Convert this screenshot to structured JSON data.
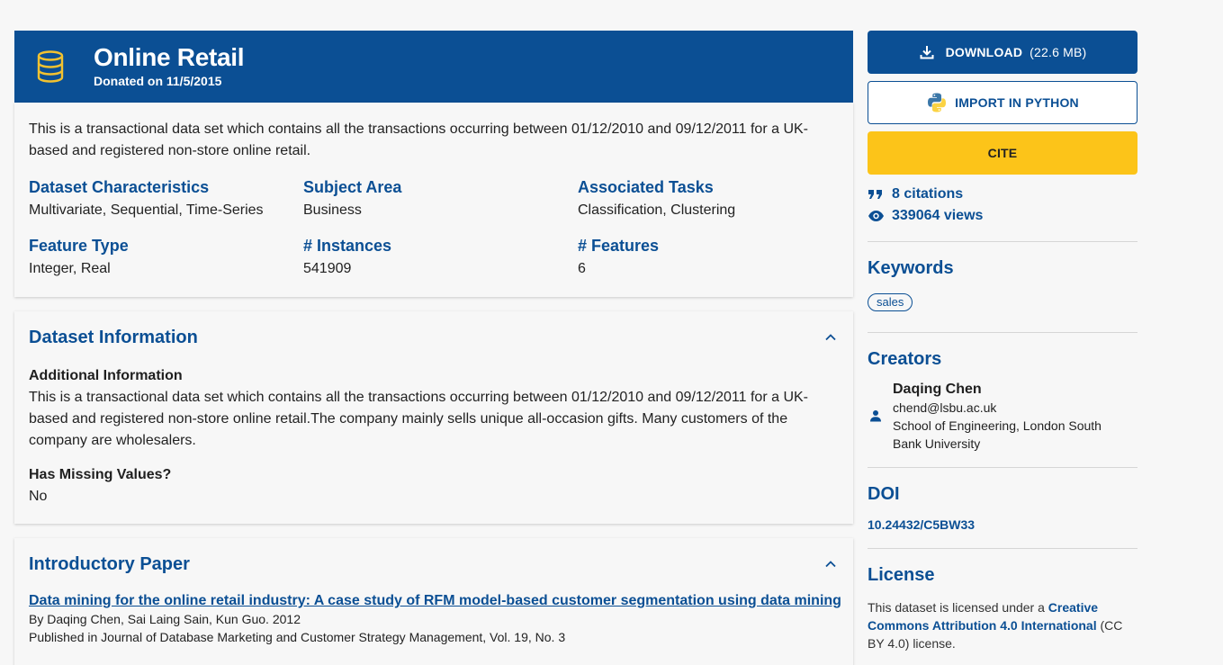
{
  "dataset": {
    "title": "Online Retail",
    "donated": "Donated on 11/5/2015",
    "summary": "This is a transactional data set which contains all the transactions occurring between 01/12/2010 and 09/12/2011 for a UK-based and registered non-store online retail."
  },
  "characteristics": [
    {
      "label": "Dataset Characteristics",
      "value": "Multivariate, Sequential, Time-Series"
    },
    {
      "label": "Subject Area",
      "value": "Business"
    },
    {
      "label": "Associated Tasks",
      "value": "Classification, Clustering"
    },
    {
      "label": "Feature Type",
      "value": "Integer, Real"
    },
    {
      "label": "# Instances",
      "value": "541909"
    },
    {
      "label": "# Features",
      "value": "6"
    }
  ],
  "info_section": {
    "heading": "Dataset Information",
    "additional_label": "Additional Information",
    "additional_text": "This is a transactional data set which contains all the transactions occurring between 01/12/2010 and 09/12/2011 for a UK-based and registered non-store online retail.The company mainly sells unique all-occasion gifts. Many customers of the company are wholesalers.",
    "missing_label": "Has Missing Values?",
    "missing_value": "No"
  },
  "paper_section": {
    "heading": "Introductory Paper",
    "title": "Data mining for the online retail industry: A case study of RFM model-based customer segmentation using data mining",
    "authors": "By Daqing Chen, Sai Laing Sain, Kun Guo. 2012",
    "published": "Published in Journal of Database Marketing and Customer Strategy Management, Vol. 19, No. 3"
  },
  "sidebar": {
    "download_label": "DOWNLOAD",
    "download_size": "(22.6 MB)",
    "import_label": "IMPORT IN PYTHON",
    "cite_label": "CITE",
    "citations": "8 citations",
    "views": "339064 views",
    "keywords_heading": "Keywords",
    "keywords": [
      "sales"
    ],
    "creators_heading": "Creators",
    "creator": {
      "name": "Daqing Chen",
      "email": "chend@lsbu.ac.uk",
      "affiliation": "School of Engineering, London South Bank University"
    },
    "doi_heading": "DOI",
    "doi": "10.24432/C5BW33",
    "license_heading": "License",
    "license_prefix": "This dataset is licensed under a ",
    "license_link": "Creative Commons Attribution 4.0 International",
    "license_suffix": " (CC BY 4.0) license."
  },
  "icons": {
    "database": "database-icon",
    "download": "download-icon",
    "python": "python-icon",
    "quote": "quote-icon",
    "eye": "eye-icon",
    "person": "person-icon",
    "chevron": "chevron-up-icon"
  },
  "colors": {
    "primary": "#0b4f94",
    "accent": "#fcc419",
    "database_icon": "#f2c230"
  }
}
